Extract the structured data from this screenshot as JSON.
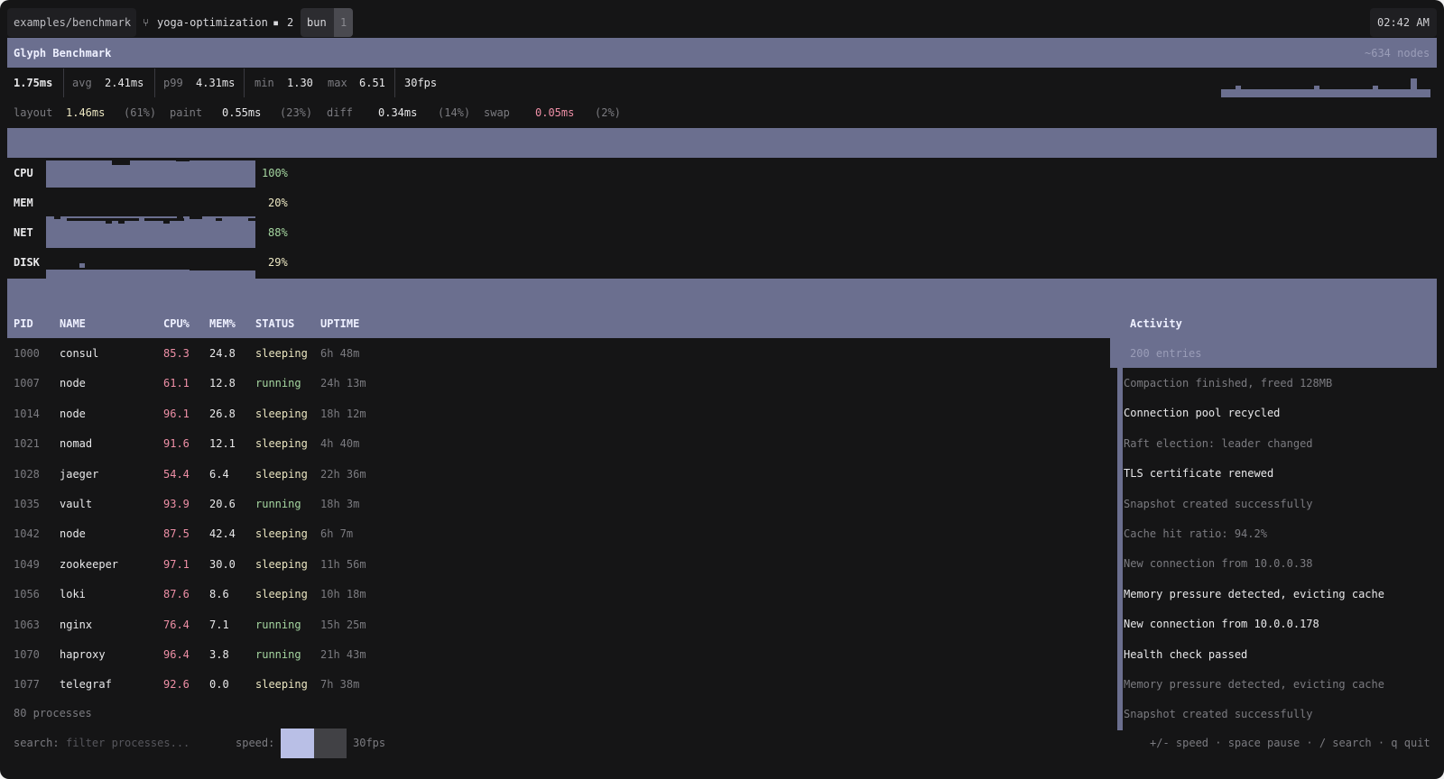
{
  "topbar": {
    "path": "examples/benchmark",
    "branch": "yoga-optimization",
    "dirty_count": "2",
    "runtime": "bun",
    "runtime_count": "1",
    "clock": "02:42 AM"
  },
  "header": {
    "title": "Glyph Benchmark",
    "nodes": "~634 nodes"
  },
  "stats": {
    "current": "1.75ms",
    "avg_label": "avg",
    "avg": "2.41ms",
    "p99_label": "p99",
    "p99": "4.31ms",
    "min_label": "min",
    "min": "1.30",
    "max_label": "max",
    "max": "6.51",
    "fps": "30fps"
  },
  "breakdown": {
    "layout_label": "layout",
    "layout": "1.46ms",
    "layout_pct": "(61%)",
    "paint_label": "paint",
    "paint": "0.55ms",
    "paint_pct": "(23%)",
    "diff_label": "diff",
    "diff": "0.34ms",
    "diff_pct": "(14%)",
    "swap_label": "swap",
    "swap": "0.05ms",
    "swap_pct": "(2%)"
  },
  "meters": [
    {
      "label": "CPU",
      "value": "100%",
      "level": 1.0
    },
    {
      "label": "MEM",
      "value": "20%",
      "level": 0.2
    },
    {
      "label": "NET",
      "value": "88%",
      "level": 0.88
    },
    {
      "label": "DISK",
      "value": "29%",
      "level": 0.29
    }
  ],
  "table": {
    "headers": {
      "pid": "PID",
      "name": "NAME",
      "cpu": "CPU%",
      "mem": "MEM%",
      "status": "STATUS",
      "uptime": "UPTIME"
    },
    "rows": [
      {
        "pid": "1000",
        "name": "consul",
        "cpu": "85.3",
        "mem": "24.8",
        "status": "sleeping",
        "uptime": "6h 48m"
      },
      {
        "pid": "1007",
        "name": "node",
        "cpu": "61.1",
        "mem": "12.8",
        "status": "running",
        "uptime": "24h 13m"
      },
      {
        "pid": "1014",
        "name": "node",
        "cpu": "96.1",
        "mem": "26.8",
        "status": "sleeping",
        "uptime": "18h 12m"
      },
      {
        "pid": "1021",
        "name": "nomad",
        "cpu": "91.6",
        "mem": "12.1",
        "status": "sleeping",
        "uptime": "4h 40m"
      },
      {
        "pid": "1028",
        "name": "jaeger",
        "cpu": "54.4",
        "mem": "6.4",
        "status": "sleeping",
        "uptime": "22h 36m"
      },
      {
        "pid": "1035",
        "name": "vault",
        "cpu": "93.9",
        "mem": "20.6",
        "status": "running",
        "uptime": "18h 3m"
      },
      {
        "pid": "1042",
        "name": "node",
        "cpu": "87.5",
        "mem": "42.4",
        "status": "sleeping",
        "uptime": "6h 7m"
      },
      {
        "pid": "1049",
        "name": "zookeeper",
        "cpu": "97.1",
        "mem": "30.0",
        "status": "sleeping",
        "uptime": "11h 56m"
      },
      {
        "pid": "1056",
        "name": "loki",
        "cpu": "87.6",
        "mem": "8.6",
        "status": "sleeping",
        "uptime": "10h 18m"
      },
      {
        "pid": "1063",
        "name": "nginx",
        "cpu": "76.4",
        "mem": "7.1",
        "status": "running",
        "uptime": "15h 25m"
      },
      {
        "pid": "1070",
        "name": "haproxy",
        "cpu": "96.4",
        "mem": "3.8",
        "status": "running",
        "uptime": "21h 43m"
      },
      {
        "pid": "1077",
        "name": "telegraf",
        "cpu": "92.6",
        "mem": "0.0",
        "status": "sleeping",
        "uptime": "7h 38m"
      }
    ],
    "footer": "80 processes"
  },
  "activity": {
    "title": "Activity",
    "count": "200 entries",
    "items": [
      {
        "text": "Compaction finished, freed 128MB",
        "bright": false
      },
      {
        "text": "Connection pool recycled",
        "bright": true
      },
      {
        "text": "Raft election: leader changed",
        "bright": false
      },
      {
        "text": "TLS certificate renewed",
        "bright": true
      },
      {
        "text": "Snapshot created successfully",
        "bright": false
      },
      {
        "text": "Cache hit ratio: 94.2%",
        "bright": false
      },
      {
        "text": "New connection from 10.0.0.38",
        "bright": false
      },
      {
        "text": "Memory pressure detected, evicting cache",
        "bright": true
      },
      {
        "text": "New connection from 10.0.0.178",
        "bright": true
      },
      {
        "text": "Health check passed",
        "bright": true
      },
      {
        "text": "Memory pressure detected, evicting cache",
        "bright": false
      },
      {
        "text": "Snapshot created successfully",
        "bright": false
      }
    ]
  },
  "bottom": {
    "search_label": "search:",
    "search_placeholder": "filter processes...",
    "speed_label": "speed:",
    "speed_fps": "30fps",
    "help": "+/- speed · space pause · / search · q quit"
  },
  "colors": {
    "background": "#151516",
    "band": "#6b6f8f",
    "running": "#a5d6a0",
    "sleeping": "#ece7c2",
    "cpu_value": "#ee8fa6",
    "speed_fill": "#b9bfe6"
  }
}
